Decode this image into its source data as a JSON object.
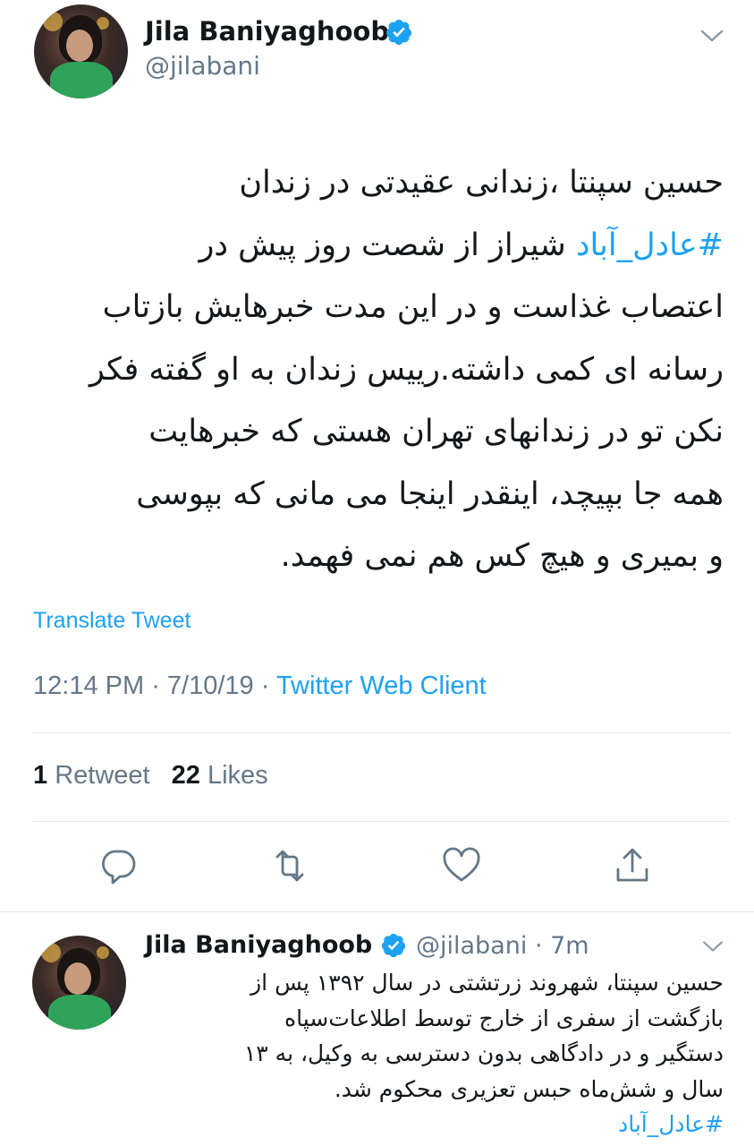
{
  "colors": {
    "accent": "#1da1f2",
    "text": "#14171a",
    "muted": "#657786",
    "divider": "#e1e8ed"
  },
  "main_tweet": {
    "author_name": "Jila Baniyaghoob",
    "author_handle": "@jilabani",
    "verified": true,
    "text_lines": [
      {
        "before": "",
        "hashtag": "",
        "after": "حسین سپنتا ،زندانی عقیدتی در زندان"
      },
      {
        "before": "",
        "hashtag": "#عادل_آباد",
        "after": " شیراز از شصت روز پیش  در"
      },
      {
        "before": "",
        "hashtag": "",
        "after": "اعتصاب غذاست و در این مدت خبرهایش بازتاب"
      },
      {
        "before": "",
        "hashtag": "",
        "after": "رسانه ای کمی داشته.رییس زندان به او گفته فکر"
      },
      {
        "before": "",
        "hashtag": "",
        "after": "نکن تو در زندانهای تهران هستی که خبرهایت"
      },
      {
        "before": "",
        "hashtag": "",
        "after": "همه جا بپیچد، اینقدر اینجا می مانی که بپوسی"
      },
      {
        "before": "",
        "hashtag": "",
        "after": "و بمیری و هیچ کس هم نمی فهمد."
      }
    ],
    "translate_label": "Translate Tweet",
    "time": "12:14 PM",
    "date": "7/10/19",
    "separator": " · ",
    "client": "Twitter Web Client",
    "retweet_count": "1",
    "retweet_label": "Retweet",
    "like_count": "22",
    "like_label": "Likes",
    "actions": [
      "reply-icon",
      "retweet-icon",
      "like-icon",
      "share-icon"
    ]
  },
  "reply_tweet": {
    "author_name": "Jila Baniyaghoob",
    "author_handle": "@jilabani",
    "age": "7m",
    "age_separator": " · ",
    "verified": true,
    "text_lines": [
      {
        "hashtag": "",
        "after": "حسین سپنتا، شهروند زرتشتی  در سال ۱۳۹۲ پس از"
      },
      {
        "hashtag": "",
        "after": "بازگشت از سفری از خارج  توسط اطلاعات‌سپاه"
      },
      {
        "hashtag": "",
        "after": "دستگیر و در دادگاهی بدون دسترسی به وکیل، به ۱۳"
      },
      {
        "hashtag": "",
        "after": "سال و شش‌ماه حبس تعزیری محکوم شد."
      },
      {
        "hashtag": "#عادل_آباد",
        "after": ""
      }
    ]
  }
}
